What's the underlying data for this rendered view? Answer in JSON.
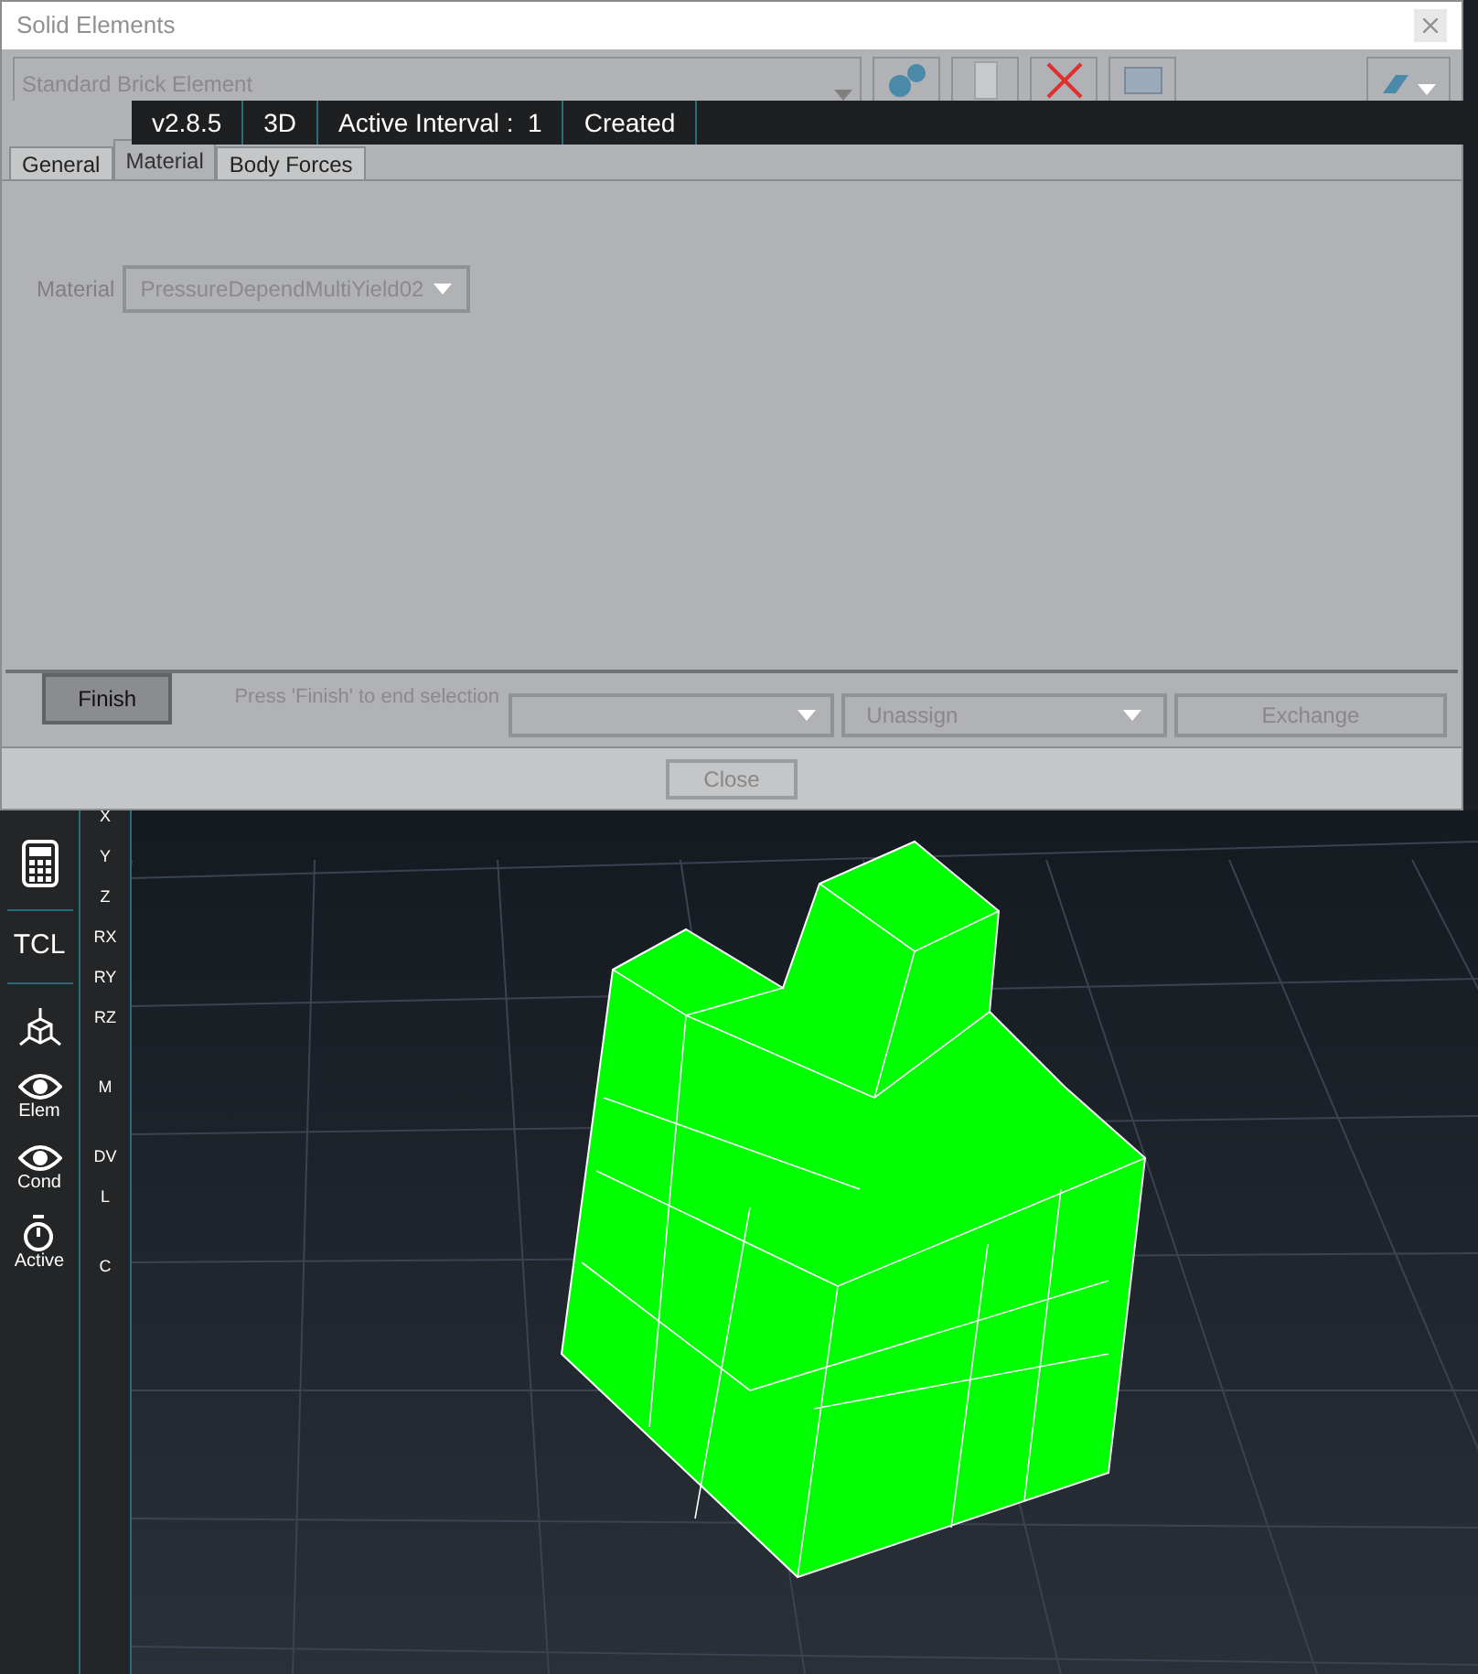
{
  "window": {
    "title": "Solid Elements"
  },
  "element_type": {
    "value": "Standard Brick Element"
  },
  "status_bar": [
    "v2.8.5",
    "3D",
    "Active Interval :  1",
    "Created"
  ],
  "tabs": [
    {
      "label": "General",
      "selected": false
    },
    {
      "label": "Material",
      "selected": true
    },
    {
      "label": "Body Forces",
      "selected": false
    }
  ],
  "material": {
    "label": "Material",
    "value": "PressureDependMultiYield02"
  },
  "finish_button": "Finish",
  "hint": "Press 'Finish' to end selection",
  "unassign_dropdown": "Unassign",
  "exchange_button": "Exchange",
  "close_button": "Close",
  "sidebar": [
    {
      "kind": "calculator"
    },
    {
      "kind": "text",
      "label": "TCL"
    },
    {
      "kind": "axes"
    },
    {
      "kind": "eye",
      "label": "Elem"
    },
    {
      "kind": "eye",
      "label": "Cond"
    },
    {
      "kind": "timer",
      "label": "Active"
    }
  ],
  "dof_column": [
    {
      "label": "X"
    },
    {
      "label": "Y"
    },
    {
      "label": "Z"
    },
    {
      "label": "RX"
    },
    {
      "label": "RY"
    },
    {
      "label": "RZ"
    },
    {
      "label": "M"
    },
    {
      "label": "DV"
    },
    {
      "label": "L"
    },
    {
      "label": "C"
    }
  ]
}
